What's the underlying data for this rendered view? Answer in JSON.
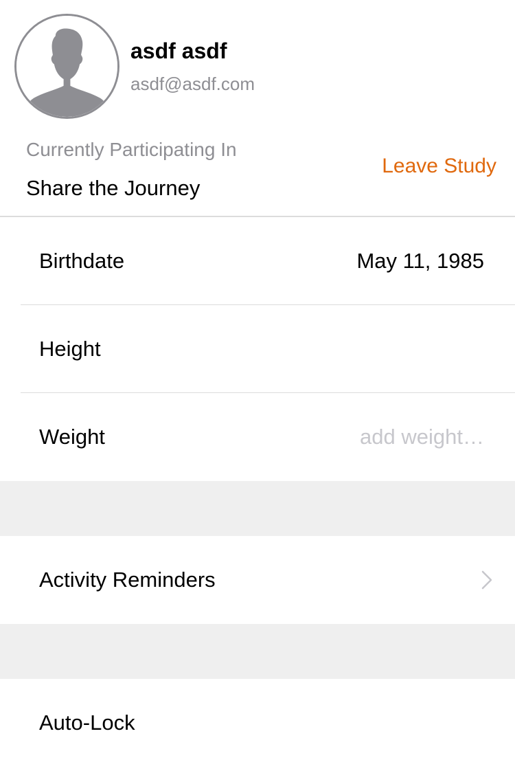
{
  "profile": {
    "name": "asdf asdf",
    "email": "asdf@asdf.com",
    "avatar_icon": "person-silhouette-icon"
  },
  "study": {
    "label": "Currently Participating In",
    "name": "Share the Journey",
    "leave_label": "Leave Study"
  },
  "details": {
    "birthdate_label": "Birthdate",
    "birthdate_value": "May 11, 1985",
    "height_label": "Height",
    "height_value": "",
    "weight_label": "Weight",
    "weight_placeholder": "add weight…"
  },
  "settings": {
    "activity_reminders_label": "Activity Reminders",
    "auto_lock_label": "Auto-Lock"
  },
  "colors": {
    "accent": "#e0690e",
    "secondary_text": "#8e8e93",
    "placeholder_text": "#c7c7cc",
    "section_background": "#efefef"
  }
}
